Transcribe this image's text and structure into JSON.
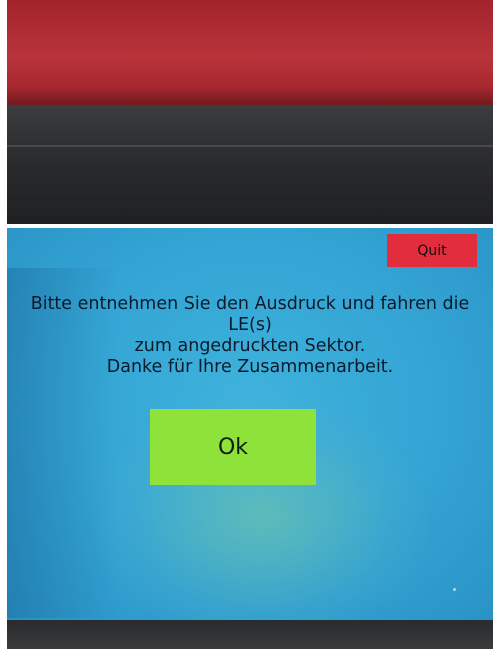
{
  "dialog": {
    "quit_label": "Quit",
    "message_lines": [
      "Bitte entnehmen Sie den Ausdruck und fahren die",
      "LE(s)",
      "zum angedruckten Sektor.",
      "Danke für Ihre Zusammenarbeit."
    ],
    "ok_label": "Ok"
  },
  "colors": {
    "screen_background": "#33a4d4",
    "quit_button": "#e12d3c",
    "ok_button": "#8ee23a",
    "housing": "#b8333a"
  }
}
